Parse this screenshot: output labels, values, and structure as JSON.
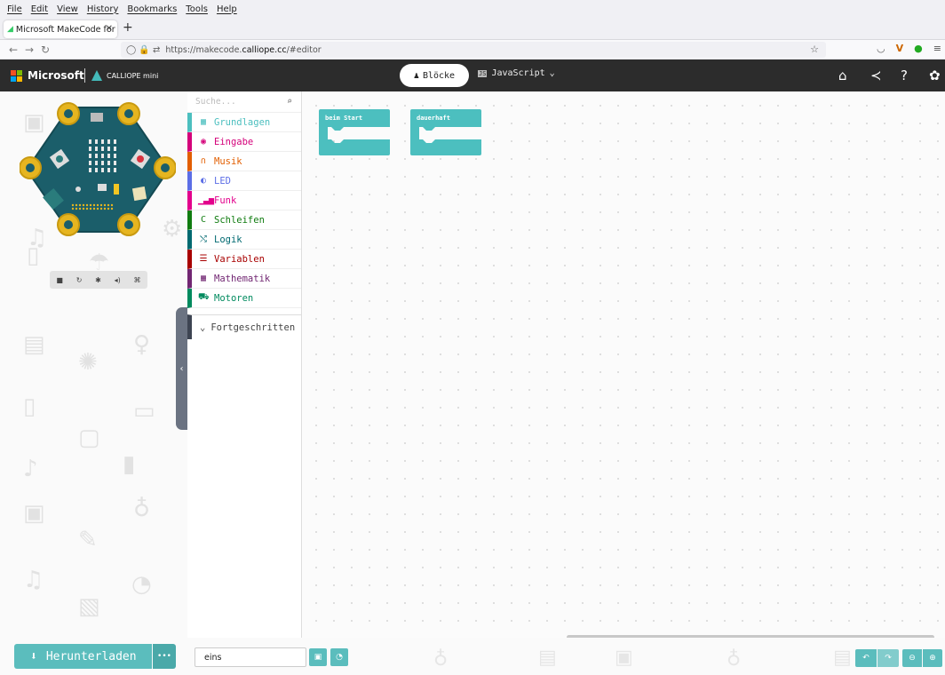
{
  "browser": {
    "menu": [
      "File",
      "Edit",
      "View",
      "History",
      "Bookmarks",
      "Tools",
      "Help"
    ],
    "tab_title": "Microsoft MakeCode for C",
    "url_prefix": "https://makecode.",
    "url_domain": "calliope.cc",
    "url_suffix": "/#editor"
  },
  "header": {
    "brand": "Microsoft",
    "product": "CALLIOPE mini",
    "tab_blocks": "Blöcke",
    "tab_javascript": "JavaScript"
  },
  "toolbox": {
    "search_placeholder": "Suche...",
    "categories": [
      {
        "label": "Grundlagen",
        "color": "#4cbfbf",
        "icon": "grid-icon"
      },
      {
        "label": "Eingabe",
        "color": "#d4017a",
        "icon": "target-icon"
      },
      {
        "label": "Musik",
        "color": "#e25e00",
        "icon": "headphones-icon"
      },
      {
        "label": "LED",
        "color": "#5c6ee6",
        "icon": "toggle-icon"
      },
      {
        "label": "Funk",
        "color": "#e3008c",
        "icon": "signal-icon"
      },
      {
        "label": "Schleifen",
        "color": "#107c10",
        "icon": "refresh-icon"
      },
      {
        "label": "Logik",
        "color": "#006970",
        "icon": "shuffle-icon"
      },
      {
        "label": "Variablen",
        "color": "#a80000",
        "icon": "list-icon"
      },
      {
        "label": "Mathematik",
        "color": "#712672",
        "icon": "calculator-icon"
      },
      {
        "label": "Motoren",
        "color": "#008a5e",
        "icon": "car-icon"
      }
    ],
    "advanced_label": "Fortgeschritten"
  },
  "workspace": {
    "block_on_start": "beim Start",
    "block_forever": "dauerhaft",
    "block_color": "#4cbfbf"
  },
  "bottom": {
    "download_label": "Herunterladen",
    "project_name": "eins"
  }
}
